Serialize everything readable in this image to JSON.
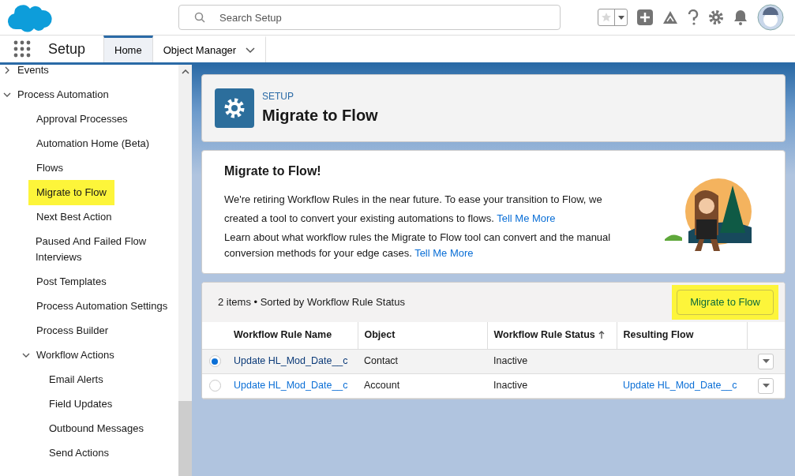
{
  "header": {
    "search": {
      "placeholder": "Search Setup"
    }
  },
  "nav": {
    "app_name": "Setup",
    "tabs": [
      {
        "label": "Home",
        "selected": true,
        "menu": false
      },
      {
        "label": "Object Manager",
        "selected": false,
        "menu": true
      }
    ]
  },
  "sidebar": {
    "items": [
      {
        "label": "Events",
        "expanded": false,
        "highlighted": false
      },
      {
        "label": "Process Automation",
        "expanded": true,
        "highlighted": false,
        "children": [
          {
            "label": "Approval Processes",
            "highlighted": false
          },
          {
            "label": "Automation Home (Beta)",
            "highlighted": false
          },
          {
            "label": "Flows",
            "highlighted": false
          },
          {
            "label": "Migrate to Flow",
            "highlighted": true
          },
          {
            "label": "Next Best Action",
            "highlighted": false
          },
          {
            "label": "Paused And Failed Flow Interviews",
            "highlighted": false
          },
          {
            "label": "Post Templates",
            "highlighted": false
          },
          {
            "label": "Process Automation Settings",
            "highlighted": false
          },
          {
            "label": "Process Builder",
            "highlighted": false
          },
          {
            "label": "Workflow Actions",
            "expanded": true,
            "highlighted": false,
            "children": [
              {
                "label": "Email Alerts",
                "highlighted": false
              },
              {
                "label": "Field Updates",
                "highlighted": false
              },
              {
                "label": "Outbound Messages",
                "highlighted": false
              },
              {
                "label": "Send Actions",
                "highlighted": false
              }
            ]
          }
        ]
      }
    ]
  },
  "page_header": {
    "eyebrow": "SETUP",
    "title": "Migrate to Flow"
  },
  "intro": {
    "title": "Migrate to Flow!",
    "paragraphs": [
      {
        "text": "We're retiring Workflow Rules in the near future. To ease your transition to Flow, we created a tool to convert your existing automations to flows.",
        "link": "Tell Me More"
      },
      {
        "text": "Learn about what workflow rules the Migrate to Flow tool can convert and the manual conversion methods for your edge cases.",
        "link": "Tell Me More"
      }
    ]
  },
  "table": {
    "summary": "2 items • Sorted by Workflow Rule Status",
    "action": {
      "label": "Migrate to Flow",
      "highlighted": true
    },
    "columns": [
      {
        "label": "Workflow Rule Name",
        "sorted": false
      },
      {
        "label": "Object",
        "sorted": false
      },
      {
        "label": "Workflow Rule Status",
        "sorted": true
      },
      {
        "label": "Resulting Flow",
        "sorted": false
      }
    ],
    "rows": [
      {
        "selected": true,
        "name": "Update HL_Mod_Date__c",
        "object": "Contact",
        "status": "Inactive",
        "resulting_flow": ""
      },
      {
        "selected": false,
        "name": "Update HL_Mod_Date__c",
        "object": "Account",
        "status": "Inactive",
        "resulting_flow": "Update HL_Mod_Date__c"
      }
    ]
  }
}
